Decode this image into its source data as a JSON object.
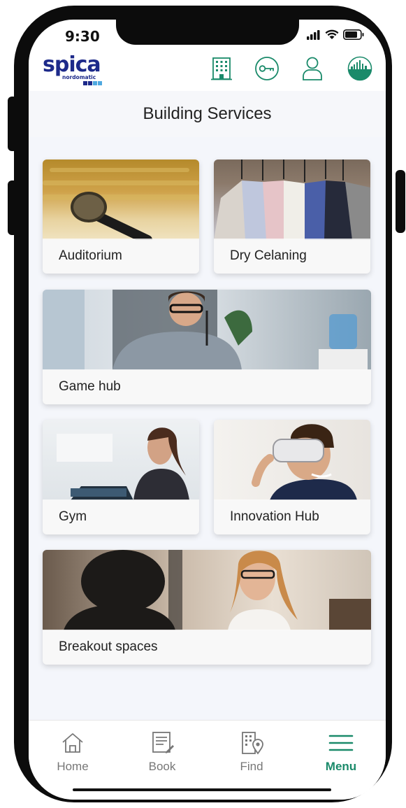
{
  "status": {
    "time": "9:30"
  },
  "header": {
    "logo_text": "spica",
    "logo_sub": "nordomatic",
    "icons": [
      "building-icon",
      "key-icon",
      "user-icon",
      "skyline-icon"
    ]
  },
  "page": {
    "title": "Building Services"
  },
  "tiles": [
    {
      "label": "Auditorium"
    },
    {
      "label": "Dry Celaning"
    },
    {
      "label": "Game hub"
    },
    {
      "label": "Gym"
    },
    {
      "label": "Innovation Hub"
    },
    {
      "label": "Breakout spaces"
    }
  ],
  "nav": [
    {
      "label": "Home",
      "icon": "home-icon",
      "active": false
    },
    {
      "label": "Book",
      "icon": "book-icon",
      "active": false
    },
    {
      "label": "Find",
      "icon": "find-icon",
      "active": false
    },
    {
      "label": "Menu",
      "icon": "menu-icon",
      "active": true
    }
  ],
  "colors": {
    "accent": "#1a8a6a",
    "brand": "#1d2a8a",
    "brand_light": "#4fa9e0"
  }
}
